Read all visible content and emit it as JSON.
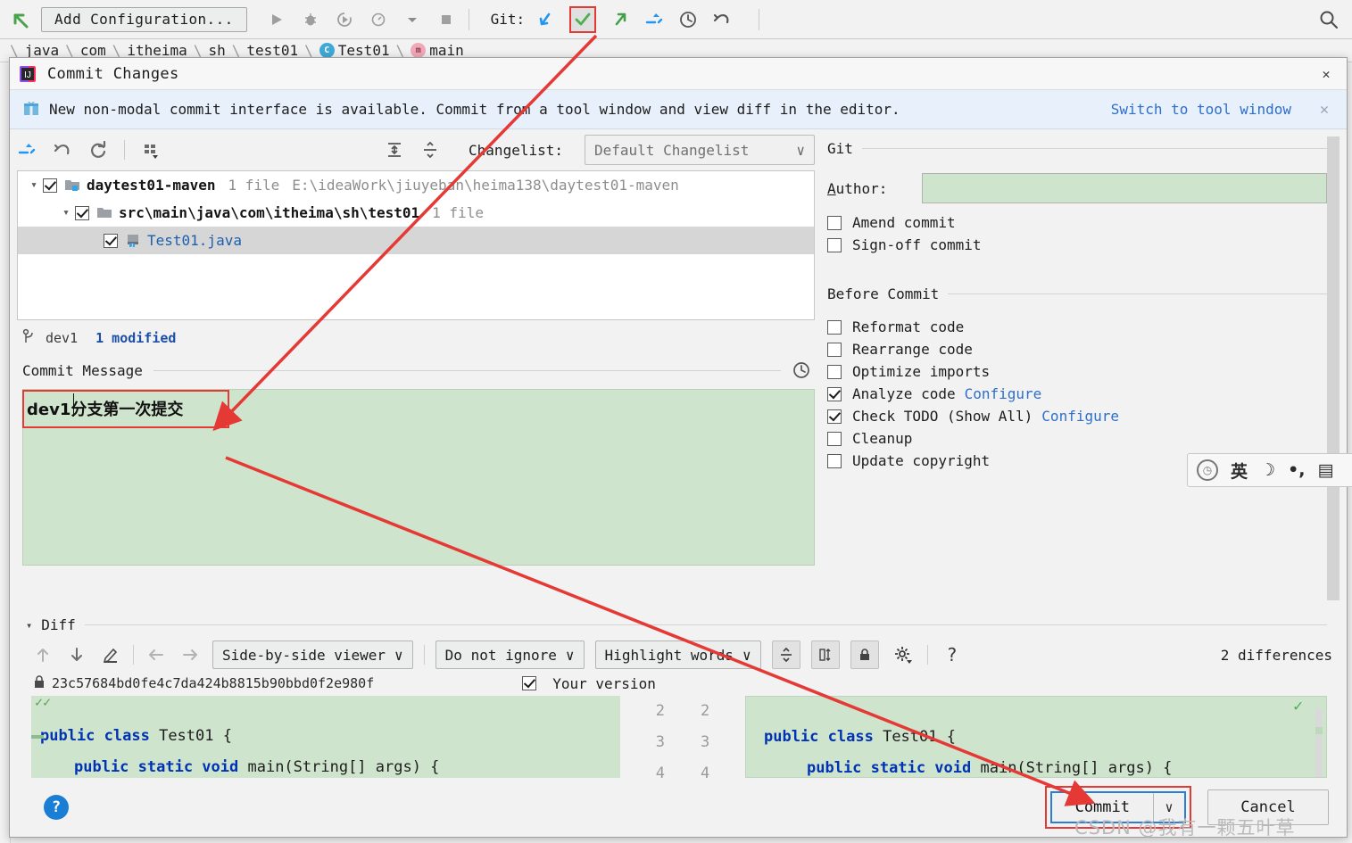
{
  "ide": {
    "add_configuration_label": "Add Configuration...",
    "git_label": "Git:",
    "breadcrumb": [
      {
        "label": "java",
        "icon": ""
      },
      {
        "label": "com",
        "icon": ""
      },
      {
        "label": "itheima",
        "icon": ""
      },
      {
        "label": "sh",
        "icon": ""
      },
      {
        "label": "test01",
        "icon": ""
      },
      {
        "label": "Test01",
        "icon": "class-badge"
      },
      {
        "label": "main",
        "icon": "method-badge"
      }
    ],
    "toolbar_icons": [
      "back-arrow-icon",
      "run-icon",
      "debug-icon",
      "run-with-coverage-icon",
      "profile-icon",
      "dropdown-icon",
      "stop-icon"
    ],
    "git_icons": [
      "update-project-icon",
      "commit-icon",
      "push-icon",
      "fetch-icon",
      "history-icon",
      "rollback-icon"
    ],
    "search_icon": "search-icon"
  },
  "dialog": {
    "title": "Commit Changes",
    "close_label": "✕",
    "banner": {
      "text": "New non-modal commit interface is available. Commit from a tool window and view diff in the editor.",
      "link": "Switch to tool window",
      "close": "✕",
      "icon": "gift-icon"
    }
  },
  "changelist": {
    "toolbar_icons": [
      "show-diff-icon",
      "revert-icon",
      "refresh-icon",
      "group-by-icon",
      "expand-all-icon",
      "collapse-all-icon"
    ],
    "label": "Changelist:",
    "selected": "Default Changelist",
    "chevron": "∨"
  },
  "tree": [
    {
      "name": "daytest01-maven",
      "count": "1 file",
      "path": "E:\\ideaWork\\jiuyeban\\heima138\\daytest01-maven",
      "checked": true,
      "expanded": true,
      "indent": 0,
      "selected": false,
      "icon": "module-folder-icon"
    },
    {
      "name": "src\\main\\java\\com\\itheima\\sh\\test01",
      "count": "1 file",
      "path": "",
      "checked": true,
      "expanded": true,
      "indent": 1,
      "selected": false,
      "icon": "folder-icon"
    },
    {
      "name": "Test01.java",
      "count": "",
      "path": "",
      "checked": true,
      "expanded": null,
      "indent": 2,
      "selected": true,
      "icon": "java-file-icon"
    }
  ],
  "branch": {
    "icon": "branch-icon",
    "name": "dev1",
    "status": "1 modified"
  },
  "commit_message": {
    "label": "Commit Message",
    "value": "dev1分支第一次提交",
    "history_icon": "clock-icon"
  },
  "git_panel": {
    "title": "Git",
    "author_label": "Author:",
    "author_value": "",
    "options": [
      {
        "label": "Amend commit",
        "checked": false
      },
      {
        "label": "Sign-off commit",
        "checked": false
      }
    ]
  },
  "before_commit": {
    "title": "Before Commit",
    "options": [
      {
        "label": "Reformat code",
        "checked": false,
        "link": ""
      },
      {
        "label": "Rearrange code",
        "checked": false,
        "link": ""
      },
      {
        "label": "Optimize imports",
        "checked": false,
        "link": ""
      },
      {
        "label": "Analyze code",
        "checked": true,
        "link": "Configure"
      },
      {
        "label": "Check TODO (Show All)",
        "checked": true,
        "link": "Configure"
      },
      {
        "label": "Cleanup",
        "checked": false,
        "link": ""
      },
      {
        "label": "Update copyright",
        "checked": false,
        "link": ""
      }
    ]
  },
  "diff": {
    "section_title": "Diff",
    "caret": "▾",
    "nav_icons": [
      "prev-difference-icon",
      "next-difference-icon",
      "edit-icon",
      "arrow-left-icon",
      "arrow-right-icon"
    ],
    "viewer_mode": "Side-by-side viewer",
    "whitespace_mode": "Do not ignore",
    "highlight_mode": "Highlight words",
    "action_icons": [
      "collapse-unchanged-icon",
      "compare-side-icon",
      "lock-icon",
      "settings-icon",
      "help-icon"
    ],
    "differences": "2 differences",
    "left_revision": "23c57684bd0fe4c7da424b8815b90bbd0f2e980f",
    "left_lock_icon": "lock-icon",
    "right_label": "Your version",
    "right_checked": true,
    "gutter_left": [
      "2",
      "3",
      "4"
    ],
    "gutter_right": [
      "2",
      "3",
      "4"
    ],
    "left_code": [
      {
        "text": "public class Test01 {",
        "indent": 0
      },
      {
        "text": "public static void main(String[] args) {",
        "indent": 1
      }
    ],
    "right_code": [
      {
        "text": "public class Test01 {",
        "indent": 0
      },
      {
        "text": "public static void main(String[] args) {",
        "indent": 1
      }
    ],
    "keywords": [
      "public",
      "class",
      "static",
      "void"
    ]
  },
  "footer": {
    "help": "?",
    "commit_label": "Commit",
    "commit_chevron": "∨",
    "cancel_label": "Cancel"
  },
  "ime": {
    "logo": "sogou-logo-icon",
    "items": [
      "英",
      "☽",
      "•,",
      "▤"
    ]
  },
  "watermark": "CSDN @我有一颗五叶草",
  "colors": {
    "accent_blue": "#2d6fcb",
    "annotation_red": "#e53935",
    "diff_green": "#cfe4cd",
    "selection_gray": "#d6d6d6",
    "banner_blue": "#e8f0fb"
  }
}
